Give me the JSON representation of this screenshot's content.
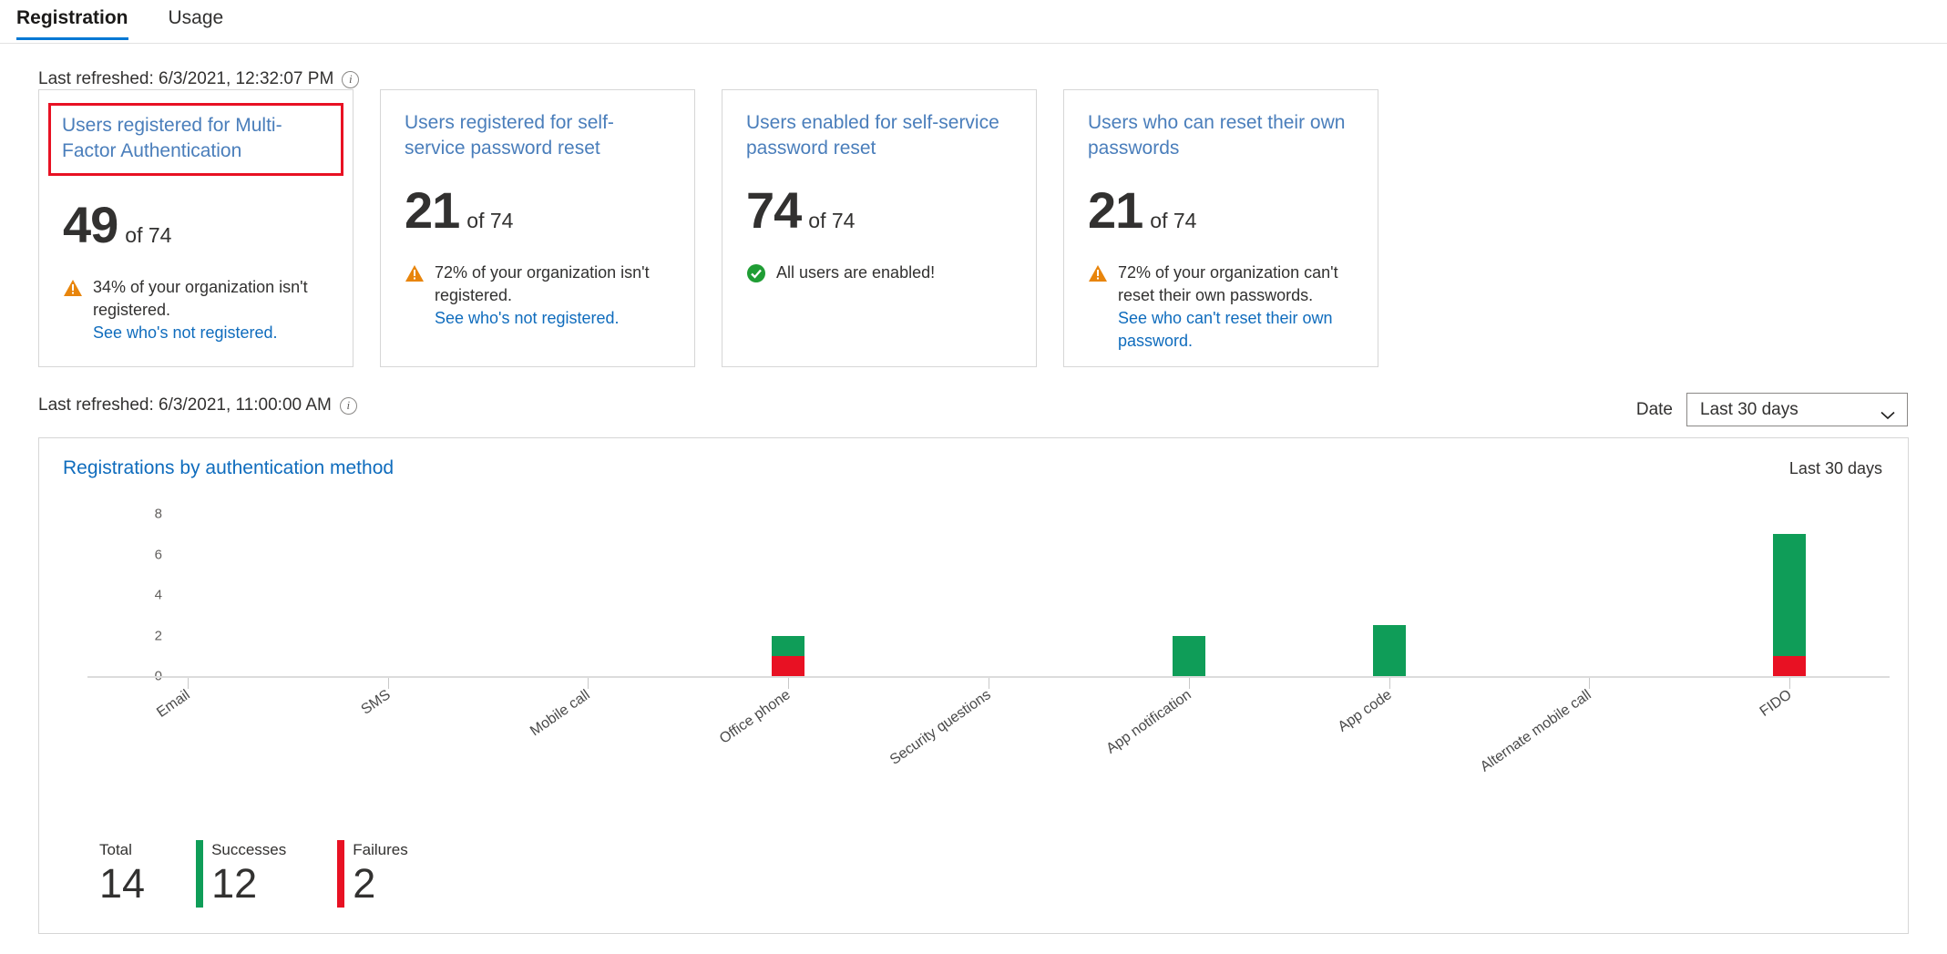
{
  "tabs": [
    {
      "label": "Registration",
      "active": true
    },
    {
      "label": "Usage",
      "active": false
    }
  ],
  "refresh_top": {
    "text": "Last refreshed: 6/3/2021, 12:32:07 PM",
    "info_glyph": "i"
  },
  "refresh_chart": {
    "text": "Last refreshed: 6/3/2021, 11:00:00 AM",
    "info_glyph": "i"
  },
  "cards": [
    {
      "title": "Users registered for Multi-Factor Authentication",
      "value": "49",
      "of": "of 74",
      "status_type": "warning",
      "status_text": "34% of your organization isn't registered.",
      "status_link": "See who's not registered.",
      "highlighted": true
    },
    {
      "title": "Users registered for self-service password reset",
      "value": "21",
      "of": "of 74",
      "status_type": "warning",
      "status_text": "72% of your organization isn't registered.",
      "status_link": "See who's not registered.",
      "highlighted": false
    },
    {
      "title": "Users enabled for self-service password reset",
      "value": "74",
      "of": "of 74",
      "status_type": "success",
      "status_text": "All users are enabled!",
      "status_link": "",
      "highlighted": false
    },
    {
      "title": "Users who can reset their own passwords",
      "value": "21",
      "of": "of 74",
      "status_type": "warning",
      "status_text": "72% of your organization can't reset their own passwords.",
      "status_link": "See who can't reset their own password.",
      "highlighted": false
    }
  ],
  "date_filter": {
    "label": "Date",
    "value": "Last 30 days"
  },
  "chart_panel": {
    "title": "Registrations by authentication method",
    "range": "Last 30 days"
  },
  "chart_data": {
    "type": "bar",
    "title": "Registrations by authentication method",
    "xlabel": "",
    "ylabel": "",
    "ylim": [
      0,
      8
    ],
    "yticks": [
      0,
      2,
      4,
      6,
      8
    ],
    "grid": false,
    "stacked": true,
    "legend_position": "bottom",
    "categories": [
      "Email",
      "SMS",
      "Mobile call",
      "Office phone",
      "Security questions",
      "App notification",
      "App code",
      "Alternate mobile call",
      "FIDO"
    ],
    "series": [
      {
        "name": "Successes",
        "color": "#0f9d58",
        "values": [
          0,
          0,
          0,
          1,
          0,
          2,
          2.5,
          0,
          6
        ]
      },
      {
        "name": "Failures",
        "color": "#e81123",
        "values": [
          0,
          0,
          0,
          1,
          0,
          0,
          0,
          0,
          1
        ]
      }
    ]
  },
  "summary": [
    {
      "label": "Total",
      "value": "14",
      "swatch": "none"
    },
    {
      "label": "Successes",
      "value": "12",
      "swatch": "green"
    },
    {
      "label": "Failures",
      "value": "2",
      "swatch": "red"
    }
  ],
  "colors": {
    "accent": "#0078d4",
    "link": "#0f6cbd",
    "card_title": "#4a7ebb",
    "success": "#0f9d58",
    "failure": "#e81123",
    "warning": "#e8850c",
    "highlight_border": "#e81123"
  }
}
